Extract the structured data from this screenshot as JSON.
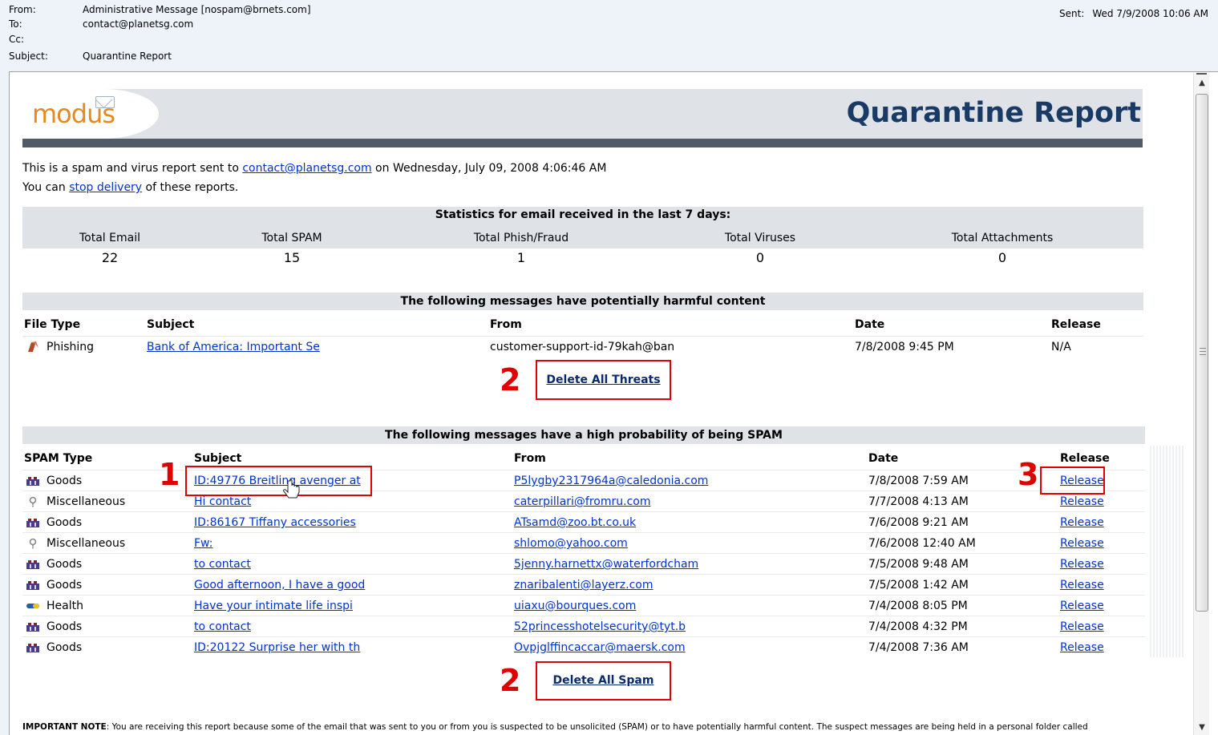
{
  "header": {
    "from_label": "From:",
    "from_value": "Administrative Message [nospam@brnets.com]",
    "to_label": "To:",
    "to_value": "contact@planetsg.com",
    "cc_label": "Cc:",
    "cc_value": "",
    "subject_label": "Subject:",
    "subject_value": "Quarantine Report",
    "sent_label": "Sent:",
    "sent_value": "Wed 7/9/2008 10:06 AM"
  },
  "banner": {
    "logo_text": "modus",
    "title": "Quarantine Report"
  },
  "intro": {
    "line1_prefix": "This is a spam and virus report sent to ",
    "line1_email": "contact@planetsg.com",
    "line1_suffix": " on Wednesday, July 09, 2008 4:06:46 AM",
    "line2_prefix": "You can ",
    "line2_link": "stop delivery",
    "line2_suffix": " of these reports."
  },
  "stats": {
    "heading": "Statistics for email received in the last 7 days:",
    "items": [
      {
        "label": "Total Email",
        "value": "22"
      },
      {
        "label": "Total SPAM",
        "value": "15"
      },
      {
        "label": "Total Phish/Fraud",
        "value": "1"
      },
      {
        "label": "Total Viruses",
        "value": "0"
      },
      {
        "label": "Total Attachments",
        "value": "0"
      }
    ]
  },
  "threats": {
    "heading": "The following messages have potentially harmful content",
    "columns": [
      "File Type",
      "Subject",
      "From",
      "Date",
      "Release"
    ],
    "rows": [
      {
        "type": "Phishing",
        "subject": "Bank of America: Important Se",
        "from": "customer-support-id-79kah@ban",
        "date": "7/8/2008 9:45 PM",
        "release": "N/A"
      }
    ],
    "delete_label": "Delete All Threats",
    "marker": "2"
  },
  "spam": {
    "heading": "The following messages have a high probability of being SPAM",
    "columns": [
      "SPAM Type",
      "Subject",
      "From",
      "Date",
      "Release"
    ],
    "rows": [
      {
        "type": "Goods",
        "icon": "goods-icon",
        "subject": "ID:49776 Breitling avenger at",
        "from": "P5lygby2317964a@caledonia.com",
        "date": "7/8/2008 7:59 AM",
        "release": "Release"
      },
      {
        "type": "Miscellaneous",
        "icon": "misc-icon",
        "subject": "Hi contact",
        "from": "caterpillari@fromru.com",
        "date": "7/7/2008 4:13 AM",
        "release": "Release"
      },
      {
        "type": "Goods",
        "icon": "goods-icon",
        "subject": "ID:86167 Tiffany accessories",
        "from": "ATsamd@zoo.bt.co.uk",
        "date": "7/6/2008 9:21 AM",
        "release": "Release"
      },
      {
        "type": "Miscellaneous",
        "icon": "misc-icon",
        "subject": "Fw:",
        "from": "shlomo@yahoo.com",
        "date": "7/6/2008 12:40 AM",
        "release": "Release"
      },
      {
        "type": "Goods",
        "icon": "goods-icon",
        "subject": "to contact",
        "from": "5jenny.harnettx@waterfordcham",
        "date": "7/5/2008 9:48 AM",
        "release": "Release"
      },
      {
        "type": "Goods",
        "icon": "goods-icon",
        "subject": "Good afternoon, I have a good",
        "from": "znaribalenti@layerz.com",
        "date": "7/5/2008 1:42 AM",
        "release": "Release"
      },
      {
        "type": "Health",
        "icon": "health-icon",
        "subject": "Have your intimate life inspi",
        "from": "uiaxu@bourques.com",
        "date": "7/4/2008 8:05 PM",
        "release": "Release"
      },
      {
        "type": "Goods",
        "icon": "goods-icon",
        "subject": "to contact",
        "from": "52princesshotelsecurity@tyt.b",
        "date": "7/4/2008 4:32 PM",
        "release": "Release"
      },
      {
        "type": "Goods",
        "icon": "goods-icon",
        "subject": "ID:20122 Surprise her with th",
        "from": "Ovpjglffincaccar@maersk.com",
        "date": "7/4/2008 7:36 AM",
        "release": "Release"
      }
    ],
    "delete_label": "Delete All Spam",
    "marker_delete": "2",
    "marker_subject": "1",
    "marker_release": "3"
  },
  "note": {
    "label": "IMPORTANT NOTE",
    "text": ": You are receiving this report because some of the email that was sent to you or from you is suspected to be unsolicited (SPAM) or to have potentially harmful content. The suspect messages are being held in a personal folder called"
  },
  "colors": {
    "link": "#0033cc",
    "section_bg": "#dfe3e8",
    "title": "#1a3a66",
    "logo": "#e58a1f",
    "annotation_red": "#e00000"
  }
}
